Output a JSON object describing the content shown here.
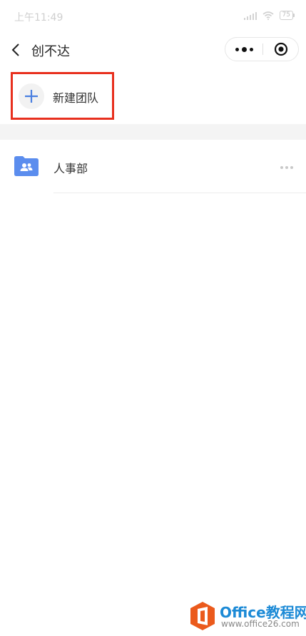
{
  "status_bar": {
    "time": "上午11:49",
    "battery": "75"
  },
  "nav": {
    "title": "创不达",
    "icons": {
      "back": "chevron-left-icon",
      "more": "more-dots-icon",
      "close": "target-close-icon"
    }
  },
  "new_team": {
    "label": "新建团队",
    "icon": "plus-icon",
    "highlight_color": "#e8301e"
  },
  "teams": [
    {
      "name": "人事部",
      "icon": "team-folder-icon"
    }
  ],
  "colors": {
    "accent": "#4a7fe0",
    "folder": "#5b8dee"
  },
  "watermark": {
    "title": "Office教程网",
    "url": "www.office26.com"
  }
}
